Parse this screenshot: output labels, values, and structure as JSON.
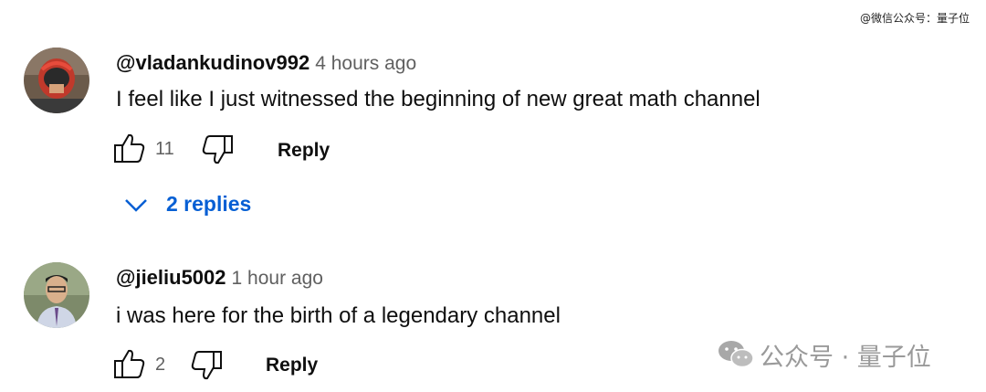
{
  "watermark_top": "@微信公众号：量子位",
  "comments": [
    {
      "author": "@vladankudinov992",
      "time": "4 hours ago",
      "text": "I feel like I just witnessed the beginning of new great math channel",
      "likes": "11",
      "reply_label": "Reply"
    },
    {
      "author": "@jieliu5002",
      "time": "1 hour ago",
      "text": "i was here for the birth of a legendary channel",
      "likes": "2",
      "reply_label": "Reply"
    }
  ],
  "replies_toggle": {
    "label": "2 replies",
    "color": "#065fd4"
  },
  "watermark_bottom": "公众号 · 量子位",
  "icons": [
    "thumb-up-icon",
    "thumb-down-icon",
    "chevron-down-icon",
    "wechat-logo-icon"
  ]
}
